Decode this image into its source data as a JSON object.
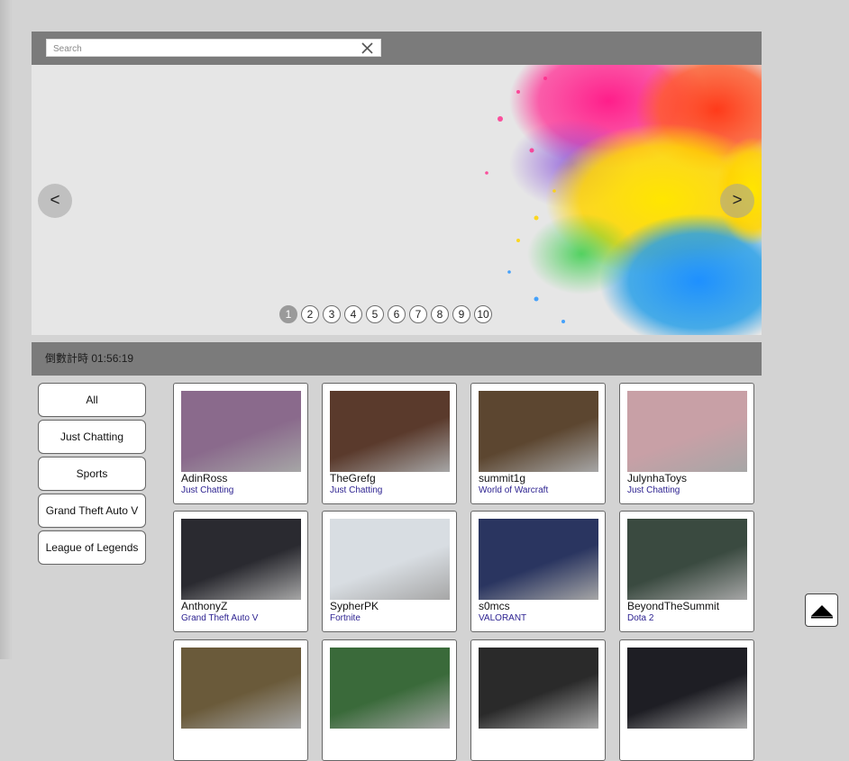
{
  "search": {
    "placeholder": "Search",
    "value": "",
    "clear_icon": "close-icon"
  },
  "carousel": {
    "prev_label": "<",
    "next_label": ">",
    "pages": [
      "1",
      "2",
      "3",
      "4",
      "5",
      "6",
      "7",
      "8",
      "9",
      "10"
    ],
    "active_page": 1
  },
  "countdown": {
    "text": "倒數計時 01:56:19"
  },
  "categories": [
    "All",
    "Just Chatting",
    "Sports",
    "Grand Theft Auto V",
    "League of Legends"
  ],
  "streams": [
    {
      "name": "AdinRoss",
      "game": "Just Chatting",
      "thumb_color": "#8a6a8c"
    },
    {
      "name": "TheGrefg",
      "game": "Just Chatting",
      "thumb_color": "#5a3a2c"
    },
    {
      "name": "summit1g",
      "game": "World of Warcraft",
      "thumb_color": "#5c4630"
    },
    {
      "name": "JulynhaToys",
      "game": "Just Chatting",
      "thumb_color": "#c8a0a6"
    },
    {
      "name": "AnthonyZ",
      "game": "Grand Theft Auto V",
      "thumb_color": "#2a2a30"
    },
    {
      "name": "SypherPK",
      "game": "Fortnite",
      "thumb_color": "#d8dde2"
    },
    {
      "name": "s0mcs",
      "game": "VALORANT",
      "thumb_color": "#2a3560"
    },
    {
      "name": "BeyondTheSummit",
      "game": "Dota 2",
      "thumb_color": "#3a4a40"
    },
    {
      "name": "",
      "game": "",
      "thumb_color": "#6a5a3a"
    },
    {
      "name": "",
      "game": "",
      "thumb_color": "#3a6a3a"
    },
    {
      "name": "",
      "game": "",
      "thumb_color": "#2a2a2a"
    },
    {
      "name": "",
      "game": "",
      "thumb_color": "#1e1e24"
    }
  ],
  "back_to_top": {
    "icon": "arrow-up-icon"
  }
}
